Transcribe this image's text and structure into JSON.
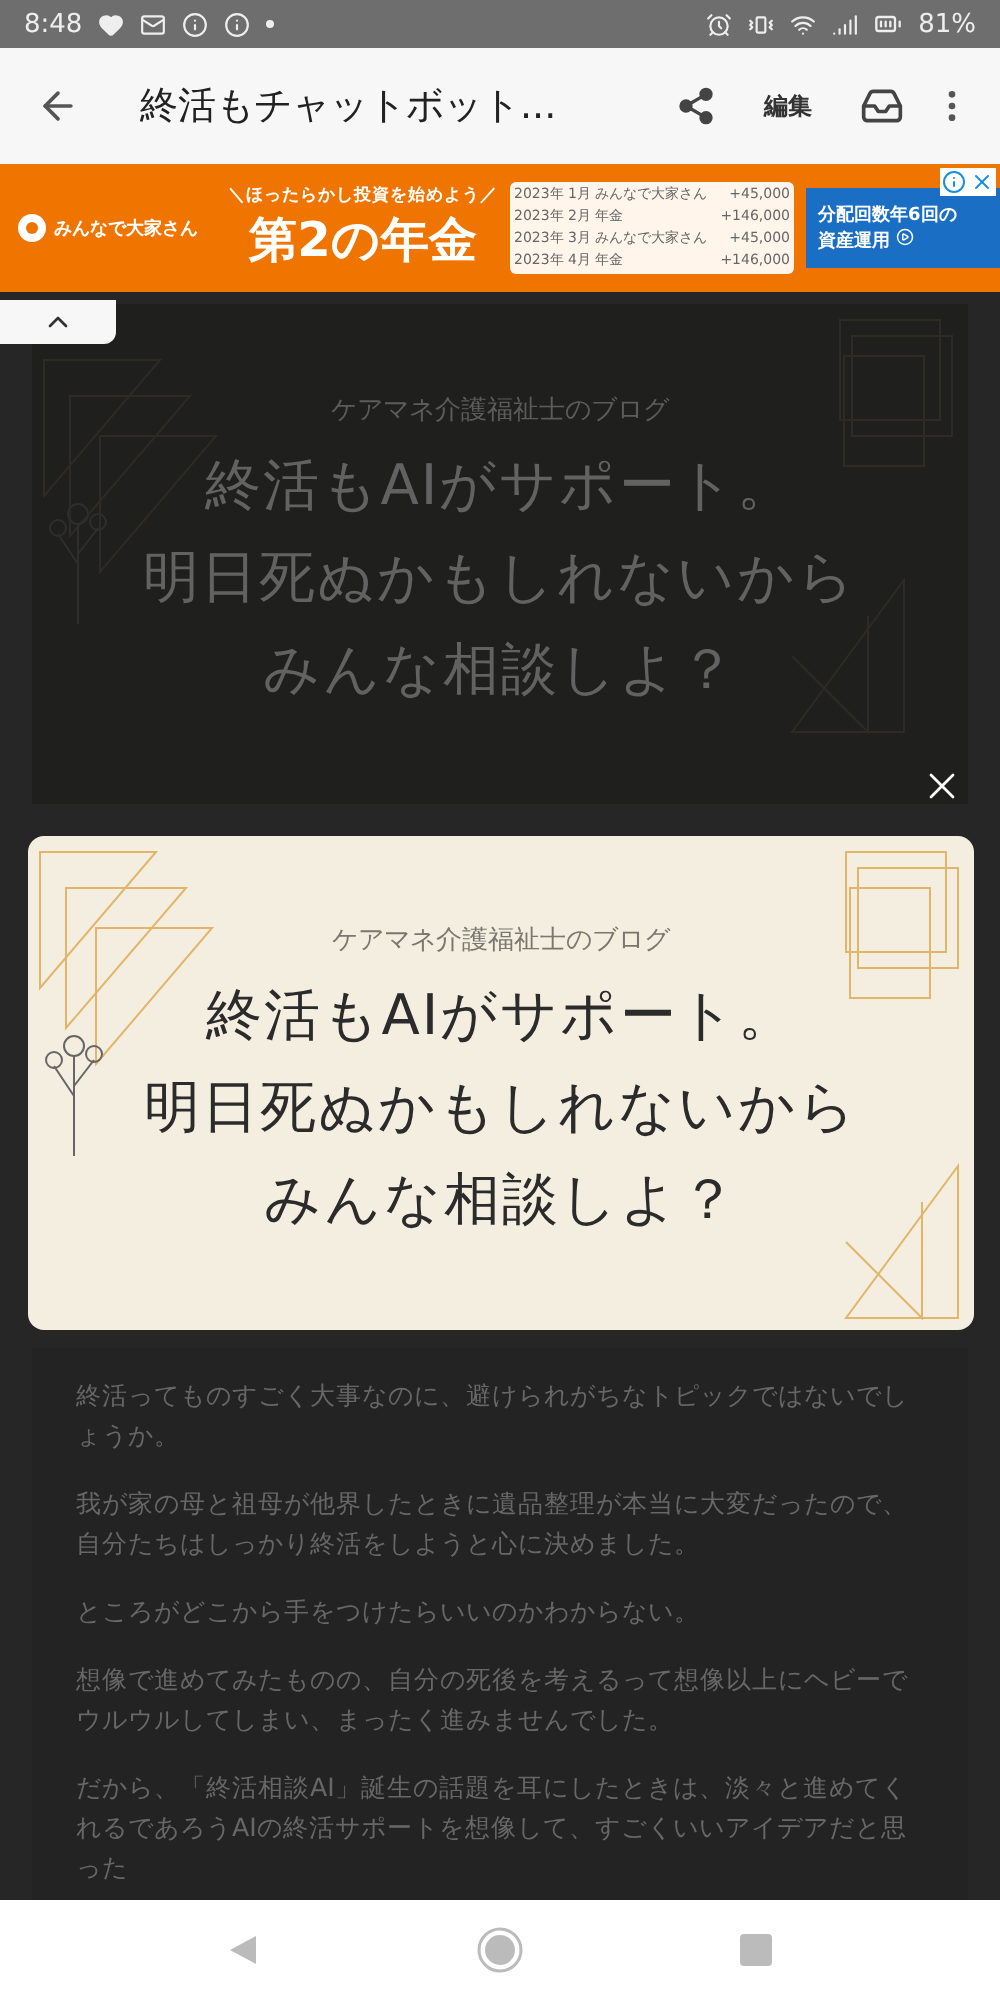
{
  "status_bar": {
    "time": "8:48",
    "battery": "81%"
  },
  "app_bar": {
    "title": "終活もチャットボット...",
    "edit": "編集"
  },
  "ad": {
    "brand": "みんなで大家さん",
    "tagline": "＼ほったらかし投資を始めよう／",
    "headline": "第2の年金",
    "table_rows": [
      {
        "month": "2023年 1月",
        "name": "みんなで大家さん",
        "amount": "+45,000"
      },
      {
        "month": "2023年 2月",
        "name": "年金",
        "amount": "+146,000"
      },
      {
        "month": "2023年 3月",
        "name": "みんなで大家さん",
        "amount": "+45,000"
      },
      {
        "month": "2023年 4月",
        "name": "年金",
        "amount": "+146,000"
      }
    ],
    "side_lines": [
      "分配回数年6回の",
      "資産運用"
    ]
  },
  "article": {
    "blog_name": "ケアマネ介護福祉士のブログ",
    "title_lines": [
      "終活もAIがサポート。",
      "明日死ぬかもしれないから",
      "みんな相談しよ？"
    ],
    "paragraphs": [
      "終活ってものすごく大事なのに、避けられがちなトピックではないでしょうか。",
      "我が家の母と祖母が他界したときに遺品整理が本当に大変だったので、自分たちはしっかり終活をしようと心に決めました。",
      "ところがどこから手をつけたらいいのかわからない。",
      "想像で進めてみたものの、自分の死後を考えるって想像以上にヘビーでウルウルしてしまい、まったく進みませんでした。",
      "だから、「終活相談AI」誕生の話題を耳にしたときは、淡々と進めてくれるであろうAIの終活サポートを想像して、すごくいいアイデアだと思った"
    ]
  },
  "popup": {
    "blog_name": "ケアマネ介護福祉士のブログ",
    "title_lines": [
      "終活もAIがサポート。",
      "明日死ぬかもしれないから",
      "みんな相談しよ？"
    ]
  }
}
